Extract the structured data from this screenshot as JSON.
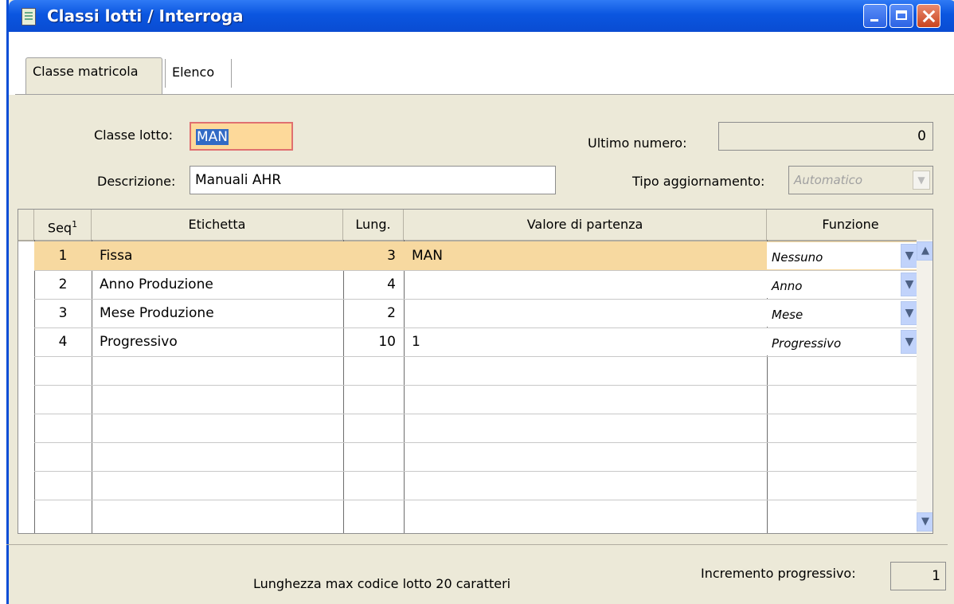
{
  "window": {
    "title": "Classi lotti / Interroga"
  },
  "tabs": [
    {
      "label": "Classe matricola",
      "active": true
    },
    {
      "label": "Elenco",
      "active": false
    }
  ],
  "form": {
    "classe_lotto_label": "Classe lotto:",
    "classe_lotto_value": "MAN",
    "descrizione_label": "Descrizione:",
    "descrizione_value": "Manuali AHR",
    "ultimo_numero_label": "Ultimo numero:",
    "ultimo_numero_value": "0",
    "tipo_aggiornamento_label": "Tipo aggiornamento:",
    "tipo_aggiornamento_value": "Automatico"
  },
  "grid": {
    "headers": {
      "seq": "Seq",
      "etichetta": "Etichetta",
      "lung": "Lung.",
      "valore": "Valore di partenza",
      "funzione": "Funzione"
    },
    "rows": [
      {
        "seq": "1",
        "etichetta": "Fissa",
        "lung": "3",
        "valore": "MAN",
        "funzione": "Nessuno"
      },
      {
        "seq": "2",
        "etichetta": "Anno Produzione",
        "lung": "4",
        "valore": "",
        "funzione": "Anno"
      },
      {
        "seq": "3",
        "etichetta": "Mese Produzione",
        "lung": "2",
        "valore": "",
        "funzione": "Mese"
      },
      {
        "seq": "4",
        "etichetta": "Progressivo",
        "lung": "10",
        "valore": "1",
        "funzione": "Progressivo"
      }
    ]
  },
  "footer": {
    "note": "Lunghezza max codice lotto 20 caratteri",
    "incremento_label": "Incremento progressivo:",
    "incremento_value": "1"
  },
  "colors": {
    "titlebar": "#0b56e0",
    "selected_row": "#f7d9a0",
    "focus_field": "#fdd99a"
  }
}
